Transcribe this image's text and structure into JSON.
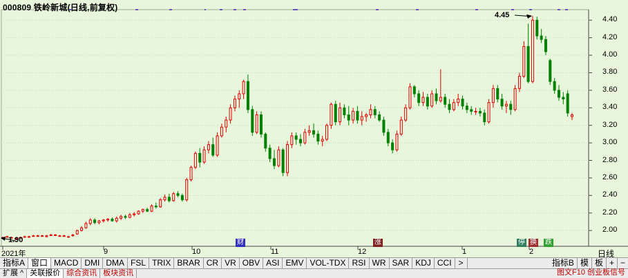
{
  "window": {
    "title": "000809 铁岭新城(日线,前复权)"
  },
  "annotations": {
    "high_label": "4.45",
    "low_label": "1.90"
  },
  "time_axis": {
    "labels": [
      "2021年",
      "9",
      "10",
      "11",
      "12",
      "1",
      "2"
    ],
    "right_label": "日线"
  },
  "event_markers": [
    {
      "label": "财",
      "color": "#3030c0"
    },
    {
      "label": "涨",
      "color": "#802020"
    },
    {
      "label": "停",
      "color": "#308060"
    },
    {
      "label": "换",
      "color": "#a03030"
    },
    {
      "label": "跌",
      "color": "#30a030"
    }
  ],
  "indicator_tabs": [
    "指标A",
    "窗口",
    "MACD",
    "DMI",
    "DMA",
    "FSL",
    "TRIX",
    "BRAR",
    "CR",
    "VR",
    "OBV",
    "ASI",
    "EMV",
    "VOL-TDX",
    "RSI",
    "WR",
    "SAR",
    "KDJ",
    "CCI",
    ">"
  ],
  "right_tabs": [
    "指标B",
    "模",
    "板",
    "+",
    "−"
  ],
  "bottom_tabs": [
    "扩展 ^",
    "关联报价",
    "综合资讯",
    "板块资讯"
  ],
  "bottom_right_text": "图文F10 创业板信号",
  "chart_data": {
    "type": "candlestick",
    "title": "000809 铁岭新城(日线,前复权)",
    "ylim": [
      1.82,
      4.52
    ],
    "yticks": [
      2.0,
      2.2,
      2.4,
      2.6,
      2.8,
      3.0,
      3.2,
      3.4,
      3.6,
      3.8,
      4.0,
      4.2,
      4.4
    ],
    "up_color": "#e00000",
    "down_color": "#008000",
    "candles": [
      [
        1.92,
        1.93,
        1.91,
        1.92
      ],
      [
        1.93,
        1.94,
        1.92,
        1.93
      ],
      [
        1.92,
        1.93,
        1.91,
        1.92
      ],
      [
        1.91,
        1.92,
        1.9,
        1.91
      ],
      [
        1.92,
        1.93,
        1.91,
        1.92
      ],
      [
        1.93,
        1.94,
        1.92,
        1.93
      ],
      [
        1.93,
        1.94,
        1.92,
        1.93
      ],
      [
        1.94,
        1.95,
        1.93,
        1.94
      ],
      [
        1.94,
        1.95,
        1.93,
        1.94
      ],
      [
        1.94,
        1.95,
        1.93,
        1.94
      ],
      [
        1.93,
        1.95,
        1.92,
        1.94
      ],
      [
        1.95,
        1.96,
        1.94,
        1.95
      ],
      [
        1.95,
        1.96,
        1.94,
        1.95
      ],
      [
        1.94,
        1.95,
        1.93,
        1.94
      ],
      [
        1.94,
        1.95,
        1.93,
        1.94
      ],
      [
        1.93,
        1.94,
        1.92,
        1.93
      ],
      [
        1.94,
        1.96,
        1.93,
        1.95
      ],
      [
        1.96,
        2.01,
        1.95,
        2.0
      ],
      [
        2.0,
        2.05,
        1.99,
        2.03
      ],
      [
        2.03,
        2.1,
        2.02,
        2.08
      ],
      [
        2.08,
        2.14,
        2.06,
        2.12
      ],
      [
        2.12,
        2.14,
        2.07,
        2.09
      ],
      [
        2.09,
        2.12,
        2.07,
        2.11
      ],
      [
        2.11,
        2.13,
        2.09,
        2.12
      ],
      [
        2.12,
        2.14,
        2.1,
        2.13
      ],
      [
        2.13,
        2.15,
        2.1,
        2.11
      ],
      [
        2.11,
        2.16,
        2.09,
        2.14
      ],
      [
        2.14,
        2.18,
        2.12,
        2.16
      ],
      [
        2.16,
        2.18,
        2.13,
        2.15
      ],
      [
        2.15,
        2.2,
        2.14,
        2.18
      ],
      [
        2.18,
        2.21,
        2.16,
        2.19
      ],
      [
        2.19,
        2.23,
        2.18,
        2.22
      ],
      [
        2.22,
        2.25,
        2.2,
        2.24
      ],
      [
        2.24,
        2.26,
        2.21,
        2.22
      ],
      [
        2.22,
        2.3,
        2.21,
        2.28
      ],
      [
        2.28,
        2.32,
        2.25,
        2.27
      ],
      [
        2.27,
        2.37,
        2.26,
        2.35
      ],
      [
        2.35,
        2.41,
        2.33,
        2.38
      ],
      [
        2.38,
        2.42,
        2.32,
        2.34
      ],
      [
        2.34,
        2.44,
        2.33,
        2.42
      ],
      [
        2.42,
        2.45,
        2.38,
        2.4
      ],
      [
        2.4,
        2.42,
        2.33,
        2.35
      ],
      [
        2.35,
        2.6,
        2.33,
        2.58
      ],
      [
        2.58,
        2.74,
        2.56,
        2.72
      ],
      [
        2.72,
        2.9,
        2.7,
        2.88
      ],
      [
        2.88,
        2.94,
        2.72,
        2.78
      ],
      [
        2.78,
        2.96,
        2.76,
        2.92
      ],
      [
        2.92,
        3.02,
        2.88,
        2.98
      ],
      [
        2.98,
        3.06,
        2.84,
        2.86
      ],
      [
        2.86,
        3.12,
        2.84,
        3.08
      ],
      [
        3.08,
        3.22,
        3.06,
        3.18
      ],
      [
        3.18,
        3.3,
        3.12,
        3.26
      ],
      [
        3.26,
        3.44,
        3.22,
        3.4
      ],
      [
        3.4,
        3.54,
        3.36,
        3.5
      ],
      [
        3.5,
        3.6,
        3.4,
        3.56
      ],
      [
        3.56,
        3.72,
        3.5,
        3.7
      ],
      [
        3.7,
        3.78,
        3.34,
        3.38
      ],
      [
        3.38,
        3.42,
        3.08,
        3.12
      ],
      [
        3.12,
        3.36,
        3.1,
        3.32
      ],
      [
        3.32,
        3.36,
        3.06,
        3.1
      ],
      [
        3.1,
        3.12,
        2.9,
        2.94
      ],
      [
        2.94,
        2.98,
        2.78,
        2.82
      ],
      [
        2.82,
        2.92,
        2.7,
        2.74
      ],
      [
        2.74,
        2.96,
        2.72,
        2.92
      ],
      [
        2.92,
        2.94,
        2.62,
        2.66
      ],
      [
        2.66,
        3.02,
        2.62,
        2.98
      ],
      [
        2.98,
        3.12,
        2.94,
        3.08
      ],
      [
        3.08,
        3.12,
        2.98,
        3.04
      ],
      [
        3.04,
        3.1,
        2.96,
        3.0
      ],
      [
        3.0,
        3.16,
        2.98,
        3.12
      ],
      [
        3.12,
        3.2,
        3.08,
        3.14
      ],
      [
        3.14,
        3.22,
        3.06,
        3.1
      ],
      [
        3.1,
        3.14,
        2.98,
        3.02
      ],
      [
        3.02,
        3.08,
        2.96,
        3.04
      ],
      [
        3.04,
        3.22,
        3.02,
        3.2
      ],
      [
        3.2,
        3.46,
        3.16,
        3.44
      ],
      [
        3.44,
        3.48,
        3.2,
        3.24
      ],
      [
        3.24,
        3.46,
        3.2,
        3.4
      ],
      [
        3.4,
        3.44,
        3.28,
        3.32
      ],
      [
        3.32,
        3.42,
        3.2,
        3.26
      ],
      [
        3.26,
        3.4,
        3.22,
        3.36
      ],
      [
        3.36,
        3.42,
        3.22,
        3.26
      ],
      [
        3.26,
        3.36,
        3.2,
        3.3
      ],
      [
        3.3,
        3.34,
        3.24,
        3.32
      ],
      [
        3.32,
        3.44,
        3.28,
        3.38
      ],
      [
        3.38,
        3.42,
        3.28,
        3.32
      ],
      [
        3.32,
        3.36,
        3.24,
        3.26
      ],
      [
        3.26,
        3.3,
        3.08,
        3.12
      ],
      [
        3.12,
        3.16,
        2.96,
        3.0
      ],
      [
        3.0,
        3.04,
        2.88,
        2.92
      ],
      [
        2.92,
        3.14,
        2.9,
        3.1
      ],
      [
        3.1,
        3.3,
        3.08,
        3.26
      ],
      [
        3.26,
        3.44,
        3.24,
        3.4
      ],
      [
        3.4,
        3.68,
        3.38,
        3.64
      ],
      [
        3.64,
        3.66,
        3.52,
        3.56
      ],
      [
        3.56,
        3.6,
        3.42,
        3.46
      ],
      [
        3.46,
        3.58,
        3.42,
        3.52
      ],
      [
        3.52,
        3.56,
        3.38,
        3.42
      ],
      [
        3.42,
        3.6,
        3.4,
        3.56
      ],
      [
        3.56,
        3.62,
        3.44,
        3.48
      ],
      [
        3.48,
        3.84,
        3.46,
        3.52
      ],
      [
        3.52,
        3.56,
        3.4,
        3.44
      ],
      [
        3.44,
        3.5,
        3.34,
        3.38
      ],
      [
        3.38,
        3.5,
        3.36,
        3.46
      ],
      [
        3.46,
        3.56,
        3.42,
        3.5
      ],
      [
        3.5,
        3.54,
        3.38,
        3.42
      ],
      [
        3.42,
        3.46,
        3.34,
        3.38
      ],
      [
        3.38,
        3.42,
        3.32,
        3.36
      ],
      [
        3.36,
        3.4,
        3.32,
        3.36
      ],
      [
        3.36,
        3.4,
        3.3,
        3.34
      ],
      [
        3.34,
        3.38,
        3.2,
        3.24
      ],
      [
        3.24,
        3.5,
        3.22,
        3.46
      ],
      [
        3.46,
        3.66,
        3.4,
        3.62
      ],
      [
        3.62,
        3.66,
        3.46,
        3.5
      ],
      [
        3.5,
        3.56,
        3.38,
        3.42
      ],
      [
        3.42,
        3.48,
        3.34,
        3.44
      ],
      [
        3.44,
        3.48,
        3.32,
        3.38
      ],
      [
        3.38,
        3.66,
        3.36,
        3.62
      ],
      [
        3.62,
        3.8,
        3.58,
        3.76
      ],
      [
        3.76,
        4.16,
        3.74,
        4.1
      ],
      [
        4.1,
        4.36,
        3.68,
        3.7
      ],
      [
        3.7,
        4.45,
        3.68,
        4.4
      ],
      [
        4.4,
        4.44,
        4.18,
        4.22
      ],
      [
        4.22,
        4.3,
        4.14,
        4.18
      ],
      [
        4.18,
        4.22,
        4.0,
        4.04
      ],
      [
        3.94,
        3.96,
        3.66,
        3.7
      ],
      [
        3.7,
        3.74,
        3.56,
        3.6
      ],
      [
        3.6,
        3.66,
        3.48,
        3.52
      ],
      [
        3.52,
        3.58,
        3.44,
        3.5
      ],
      [
        3.56,
        3.6,
        3.3,
        3.34
      ],
      [
        3.3,
        3.34,
        3.26,
        3.32
      ]
    ]
  }
}
